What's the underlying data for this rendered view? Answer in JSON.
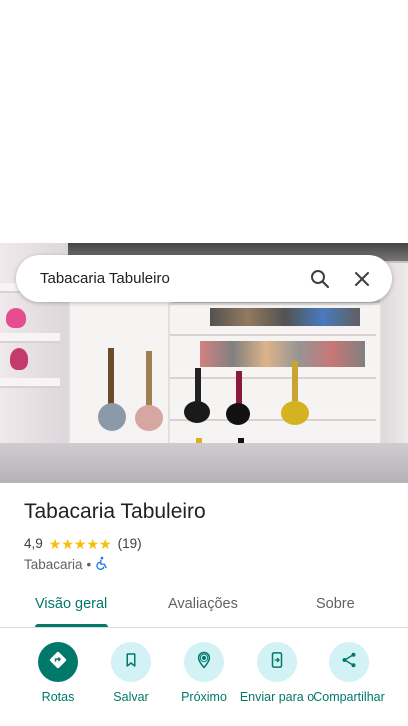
{
  "search": {
    "query": "Tabacaria Tabuleiro"
  },
  "place": {
    "name": "Tabacaria Tabuleiro",
    "rating": "4,9",
    "stars": 5,
    "review_count": "(19)",
    "category": "Tabacaria",
    "separator": "•"
  },
  "tabs": [
    {
      "label": "Visão geral",
      "active": true
    },
    {
      "label": "Avaliações",
      "active": false
    },
    {
      "label": "Sobre",
      "active": false
    }
  ],
  "actions": [
    {
      "label": "Rotas",
      "icon": "directions-icon"
    },
    {
      "label": "Salvar",
      "icon": "bookmark-icon"
    },
    {
      "label": "Próximo",
      "icon": "nearby-icon"
    },
    {
      "label": "Enviar para o",
      "icon": "send-to-phone-icon"
    },
    {
      "label": "Compartilhar",
      "icon": "share-icon"
    }
  ],
  "colors": {
    "accent": "#00796b",
    "action_bg": "#d2f2f6",
    "star": "#fbbc04"
  }
}
